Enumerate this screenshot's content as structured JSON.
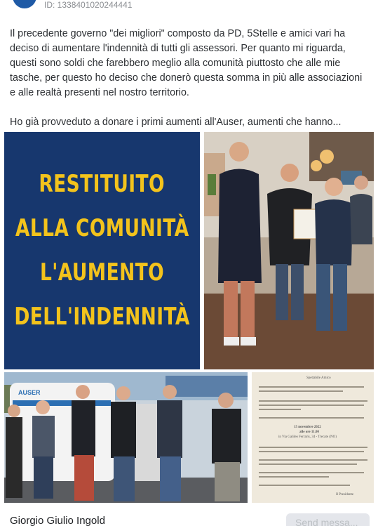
{
  "post": {
    "id_label": "ID: 1338401020244441",
    "paragraphs": [
      "Il precedente governo \"dei migliori\" composto da PD, 5Stelle e amici vari ha deciso di aumentare l'indennità di tutti gli assessori. Per quanto mi riguarda, questi sono soldi che farebbero meglio alla comunità piuttosto che alle mie tasche, per questo ho deciso che donerò questa somma in più alle associazioni e alle realtà presenti nel nostro territorio.",
      "Ho già provveduto a donare i primi aumenti all'Auser, aumenti che hanno..."
    ]
  },
  "graphic": {
    "lines": [
      "RESTITUITO",
      "ALLA COMUNITÀ",
      "L'AUMENTO",
      "DELL'INDENNITÀ"
    ],
    "background": "#17376e",
    "text_color": "#f3c31c"
  },
  "letter": {
    "heading": "Spettabile Amico",
    "date_line": "15 novembre 2022",
    "time_line": "alle ore 11.00",
    "place_line": "in Via Galileo Ferraris, 34 - Trecate (NO)",
    "signature": "Il Presidente"
  },
  "photo2": {
    "van_text": "AUSER"
  },
  "footer": {
    "commenter_name": "Giorgio Giulio Ingold",
    "send_label": "Send messa..."
  }
}
